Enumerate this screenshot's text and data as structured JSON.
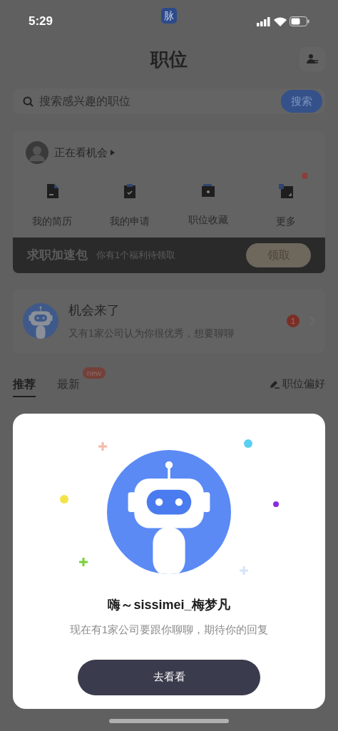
{
  "status_bar": {
    "time": "5:29",
    "app_badge": "脉"
  },
  "header": {
    "title": "职位"
  },
  "search": {
    "placeholder": "搜索感兴趣的职位",
    "button": "搜索"
  },
  "profile": {
    "status": "正在看机会"
  },
  "shortcuts": [
    {
      "kind": "resume",
      "label": "我的简历",
      "dot": false
    },
    {
      "kind": "applications",
      "label": "我的申请",
      "dot": false
    },
    {
      "kind": "favorites",
      "label": "职位收藏",
      "dot": false
    },
    {
      "kind": "more",
      "label": "更多",
      "dot": true
    }
  ],
  "boost_banner": {
    "title": "求职加速包",
    "subtitle": "你有1个福利待领取",
    "button": "领取"
  },
  "opportunity": {
    "title": "机会来了",
    "message": "又有1家公司认为你很优秀，想要聊聊",
    "count": "1"
  },
  "tabs": [
    {
      "label": "推荐",
      "selected": true
    },
    {
      "label": "最新",
      "selected": false,
      "badge": "new"
    }
  ],
  "preference_link": "职位偏好",
  "dialog": {
    "title": "嗨～sissimei_梅梦凡",
    "message": "现在有1家公司要跟你聊聊，期待你的回复",
    "button": "去看看"
  }
}
